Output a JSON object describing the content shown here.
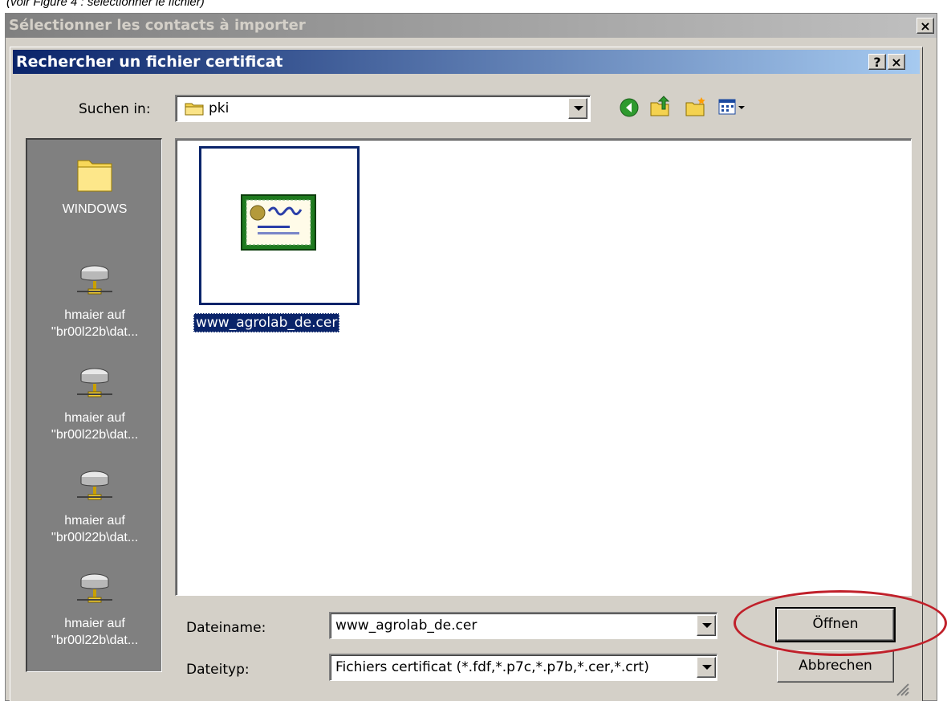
{
  "caption": "(voir Figure 4 : sélectionner le fichier)",
  "outer_dialog": {
    "title": "Sélectionner les contacts à importer",
    "close": "×"
  },
  "dialog": {
    "title": "Rechercher un fichier certificat",
    "help": "?",
    "close": "×",
    "look_in_label": "Suchen in:",
    "look_in_value": "pki",
    "places": [
      {
        "label": "WINDOWS",
        "icon": "folder-icon"
      },
      {
        "label": "hmaier auf\n''br00l22b\\dat...",
        "icon": "network-drive-icon"
      },
      {
        "label": "hmaier auf\n''br00l22b\\dat...",
        "icon": "network-drive-icon"
      },
      {
        "label": "hmaier auf\n''br00l22b\\dat...",
        "icon": "network-drive-icon"
      },
      {
        "label": "hmaier auf\n''br00l22b\\dat...",
        "icon": "network-drive-icon"
      }
    ],
    "files": [
      {
        "name": "www_agrolab_de.cer",
        "icon": "certificate-icon",
        "selected": true
      }
    ],
    "filename_label": "Dateiname:",
    "filename_value": "www_agrolab_de.cer",
    "filetype_label": "Dateityp:",
    "filetype_value": "Fichiers certificat  (*.fdf,*.p7c,*.p7b,*.cer,*.crt)",
    "open_button": "Öffnen",
    "cancel_button": "Abbrechen"
  },
  "colors": {
    "active_title": "#0a246a",
    "highlight_ring": "#c0202a",
    "face": "#d4d0c8"
  }
}
